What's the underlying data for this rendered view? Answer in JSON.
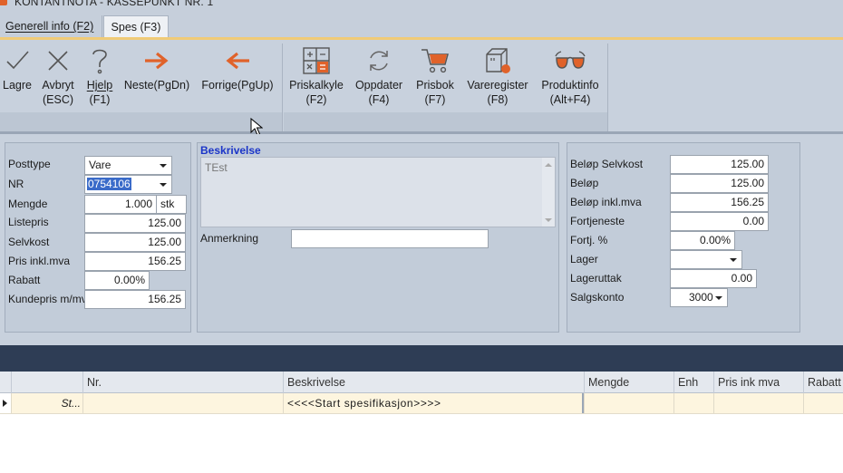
{
  "window": {
    "title": "KONTANTNOTA -  KASSEPUNKT NR. 1"
  },
  "tabs": [
    {
      "label": "Generell info (F2)"
    },
    {
      "label": "Spes (F3)"
    }
  ],
  "toolbar": {
    "lagre": {
      "label": "Lagre",
      "icon": "checkmark-icon"
    },
    "avbryt": {
      "label": "Avbryt",
      "shortcut": "(ESC)",
      "icon": "x-icon"
    },
    "hjelp": {
      "label": "Hjelp",
      "shortcut": "(F1)",
      "icon": "question-icon"
    },
    "neste": {
      "label": "Neste(PgDn)",
      "icon": "arrow-right-icon"
    },
    "forrige": {
      "label": "Forrige(PgUp)",
      "icon": "arrow-left-icon"
    },
    "priskalkyle": {
      "label": "Priskalkyle",
      "shortcut": "(F2)",
      "icon": "calculator-icon"
    },
    "oppdater": {
      "label": "Oppdater",
      "shortcut": "(F4)",
      "icon": "refresh-icon"
    },
    "prisbok": {
      "label": "Prisbok",
      "shortcut": "(F7)",
      "icon": "cart-icon"
    },
    "vareregister": {
      "label": "Vareregister",
      "shortcut": "(F8)",
      "icon": "box-icon"
    },
    "produktinfo": {
      "label": "Produktinfo",
      "shortcut": "(Alt+F4)",
      "icon": "glasses-icon"
    }
  },
  "left_panel": {
    "posttype": {
      "label": "Posttype",
      "value": "Vare"
    },
    "nr": {
      "label": "NR",
      "value": "0754106"
    },
    "mengde": {
      "label": "Mengde",
      "value": "1.000",
      "unit": "stk"
    },
    "listepris": {
      "label": "Listepris",
      "value": "125.00"
    },
    "selvkost": {
      "label": "Selvkost",
      "value": "125.00"
    },
    "pris_inkl_mva": {
      "label": "Pris inkl.mva",
      "value": "156.25"
    },
    "rabatt": {
      "label": "Rabatt",
      "value": "0.00%"
    },
    "kundepris": {
      "label": "Kundepris m/mva",
      "value": "156.25"
    }
  },
  "middle_panel": {
    "beskrivelse": {
      "label": "Beskrivelse",
      "value": "TEst"
    },
    "anmerkning": {
      "label": "Anmerkning",
      "value": ""
    }
  },
  "right_panel": {
    "belop_selvkost": {
      "label": "Beløp Selvkost",
      "value": "125.00"
    },
    "belop": {
      "label": "Beløp",
      "value": "125.00"
    },
    "belop_inkl_mva": {
      "label": "Beløp inkl.mva",
      "value": "156.25"
    },
    "fortjeneste": {
      "label": "Fortjeneste",
      "value": "0.00"
    },
    "fortj_pct": {
      "label": "Fortj. %",
      "value": "0.00%"
    },
    "lager": {
      "label": "Lager",
      "value": ""
    },
    "lageruttak": {
      "label": "Lageruttak",
      "value": "0.00"
    },
    "salgskonto": {
      "label": "Salgskonto",
      "value": "3000"
    }
  },
  "grid": {
    "columns": [
      "Nr.",
      "Beskrivelse",
      "Mengde",
      "Enh",
      "Pris ink mva",
      "Rabatt"
    ],
    "rows": [
      {
        "status": "St...",
        "nr": "",
        "beskrivelse": "<<<<Start spesifikasjon>>>>",
        "mengde": "",
        "enh": "",
        "pris": "",
        "rabatt": ""
      }
    ]
  }
}
